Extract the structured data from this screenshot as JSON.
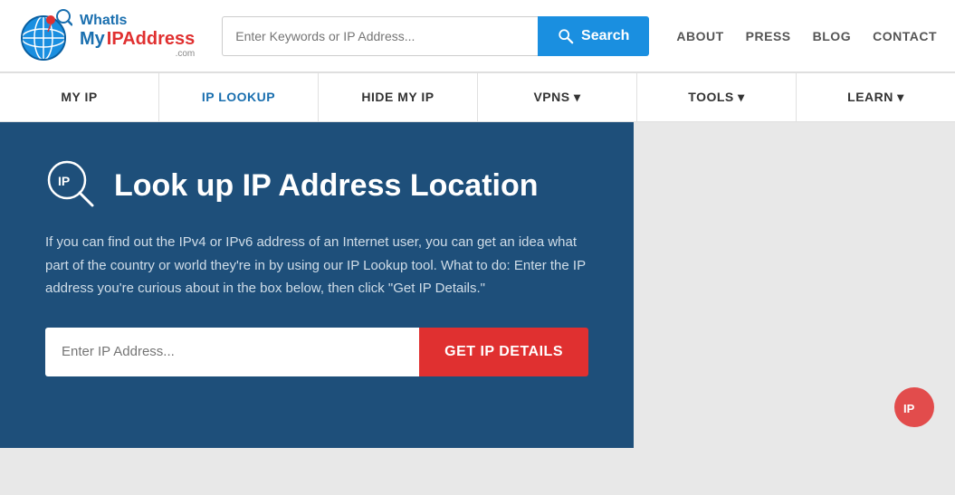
{
  "header": {
    "logo": {
      "what_is": "WhatIs",
      "my_ip": "My",
      "address": "IPAddress",
      "dot_com": ".com"
    },
    "search": {
      "placeholder": "Enter Keywords or IP Address...",
      "button_label": "Search"
    },
    "nav": {
      "about": "ABOUT",
      "press": "PRESS",
      "blog": "BLOG",
      "contact": "CONTACT"
    }
  },
  "navbar": {
    "items": [
      {
        "label": "MY IP",
        "active": false
      },
      {
        "label": "IP LOOKUP",
        "active": true
      },
      {
        "label": "HIDE MY IP",
        "active": false
      },
      {
        "label": "VPNS ▾",
        "active": false
      },
      {
        "label": "TOOLS ▾",
        "active": false
      },
      {
        "label": "LEARN ▾",
        "active": false
      }
    ]
  },
  "hero": {
    "title": "Look up IP Address Location",
    "description": "If you can find out the IPv4 or IPv6 address of an Internet user, you can get an idea what part of the country or world they're in by using our IP Lookup tool. What to do: Enter the IP address you're curious about in the box below, then click \"Get IP Details.\"",
    "input_placeholder": "Enter IP Address...",
    "button_label": "GET IP DETAILS"
  }
}
